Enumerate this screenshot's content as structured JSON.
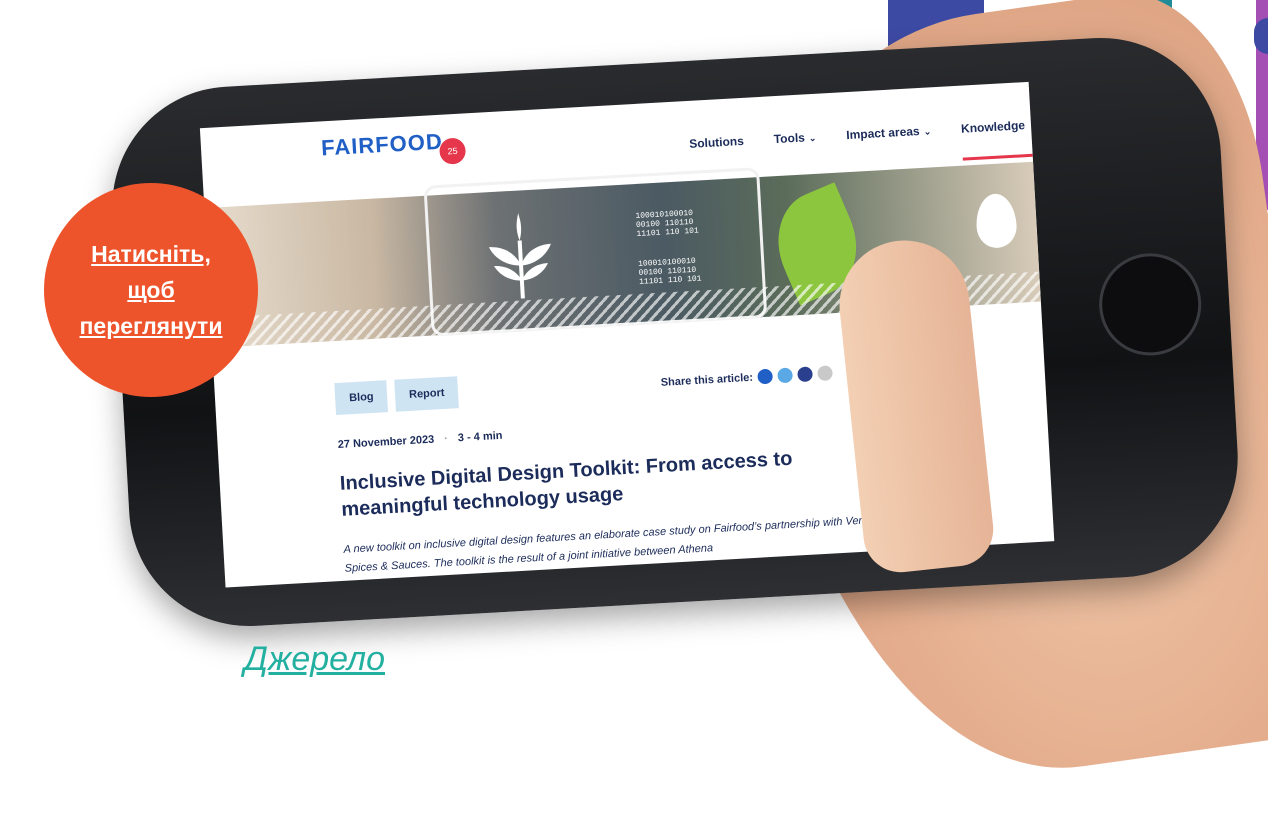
{
  "cta": {
    "label": "Натисніть,\nщоб\nпереглянути"
  },
  "source_link": {
    "label": "Джерело"
  },
  "site": {
    "logo": "FAIRFOOD",
    "logo_badge": "25",
    "nav": [
      {
        "label": "Solutions",
        "has_dropdown": false
      },
      {
        "label": "Tools",
        "has_dropdown": true
      },
      {
        "label": "Impact areas",
        "has_dropdown": true
      },
      {
        "label": "Knowledge",
        "has_dropdown": false
      }
    ],
    "hero": {
      "binary_1": "100010100010\n00100 110110\n11101 110 101",
      "binary_2": "100010100010\n00100 110110\n11101 110 101"
    },
    "tags": [
      "Blog",
      "Report"
    ],
    "share": {
      "label": "Share this article:",
      "icons": [
        "linkedin-icon",
        "twitter-icon",
        "facebook-icon",
        "email-icon"
      ]
    },
    "meta": {
      "date": "27 November 2023",
      "read_time": "3 - 4 min"
    },
    "headline": "Inclusive Digital Design Toolkit: From access to meaningful technology usage",
    "intro": "A new toolkit on inclusive digital design features an elaborate case study on Fairfood’s partnership with Verstegen Spices & Sauces. The toolkit is the result of a joint initiative between Athena"
  },
  "colors": {
    "cta": "#ee542b",
    "source_link": "#24b0a0",
    "brand_blue": "#1f5fc6",
    "navy_text": "#1c2c5a",
    "tag_bg": "#cfe4f3",
    "accent_red": "#e5364b"
  }
}
